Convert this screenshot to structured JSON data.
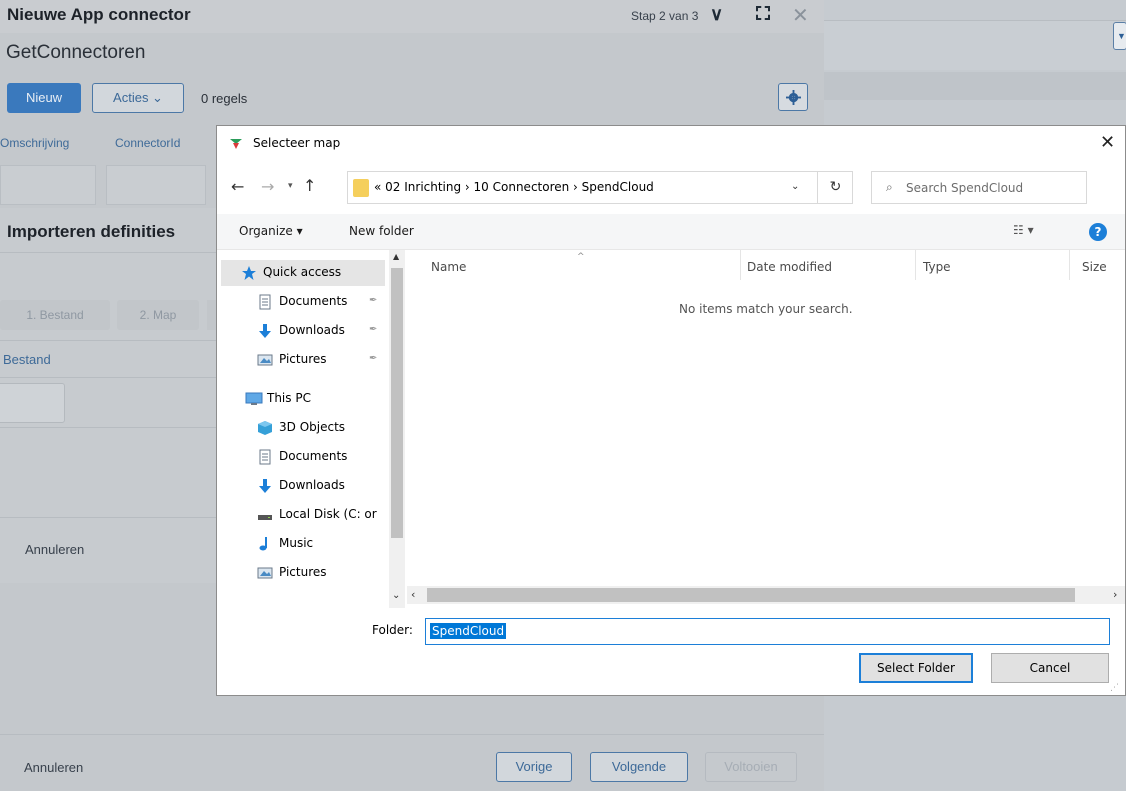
{
  "wizard": {
    "title": "Nieuwe App connector",
    "step": "Stap 2 van 3",
    "subtitle": "GetConnectoren",
    "new_label": "Nieuw",
    "acties_label": "Acties ⌄",
    "regels": "0 regels",
    "columns": [
      "Omschrijving",
      "ConnectorId"
    ],
    "import": {
      "title": "Importeren definities",
      "steps": [
        "1. Bestand",
        "2. Map"
      ],
      "bestand_label": "Bestand",
      "cancel": "Annuleren"
    },
    "footer": {
      "cancel": "Annuleren",
      "prev": "Vorige",
      "next": "Volgende",
      "finish": "Voltooien"
    }
  },
  "dialog": {
    "title": "Selecteer map",
    "address": "« 02 Inrichting  ›  10 Connectoren  ›  SpendCloud",
    "search_placeholder": "Search SpendCloud",
    "toolbar": {
      "organize": "Organize ▾",
      "new_folder": "New folder"
    },
    "nav": [
      {
        "label": "Quick access",
        "icon": "star-icon",
        "color": "#1c7fd8"
      },
      {
        "label": "Documents",
        "icon": "documents-icon",
        "pinned": true
      },
      {
        "label": "Downloads",
        "icon": "downloads-icon",
        "pinned": true
      },
      {
        "label": "Pictures",
        "icon": "pictures-icon",
        "pinned": true
      },
      {
        "label": "This PC",
        "icon": "pc-icon"
      },
      {
        "label": "3D Objects",
        "icon": "3d-objects-icon"
      },
      {
        "label": "Documents",
        "icon": "documents-icon"
      },
      {
        "label": "Downloads",
        "icon": "downloads-icon"
      },
      {
        "label": "Local Disk (C: or",
        "icon": "disk-icon"
      },
      {
        "label": "Music",
        "icon": "music-icon"
      },
      {
        "label": "Pictures",
        "icon": "pictures-icon"
      }
    ],
    "columns": {
      "name": "Name",
      "date": "Date modified",
      "type": "Type",
      "size": "Size"
    },
    "empty_message": "No items match your search.",
    "folder_label": "Folder:",
    "folder_value": "SpendCloud",
    "select_button": "Select Folder",
    "cancel_button": "Cancel"
  },
  "colors": {
    "accent": "#1c7fd8",
    "brand_blue": "#3a79bd"
  }
}
